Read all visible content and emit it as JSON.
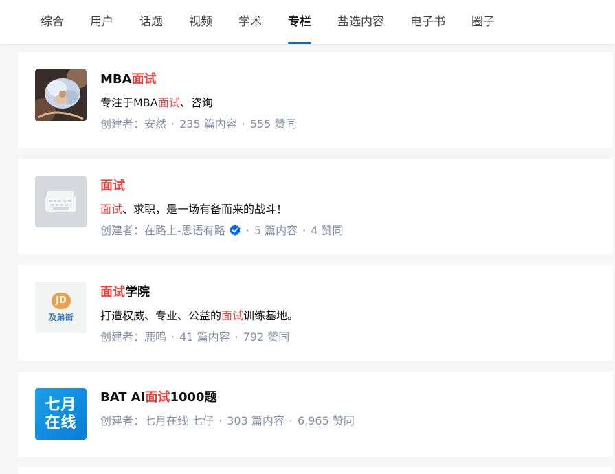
{
  "tabs": [
    "综合",
    "用户",
    "话题",
    "视频",
    "学术",
    "专栏",
    "盐选内容",
    "电子书",
    "圈子"
  ],
  "active_tab_index": 5,
  "meta_prefix": "创建者：",
  "separator": "·",
  "colors": {
    "accent": "#0066ff",
    "highlight": "#f1403c",
    "meta": "#8590a6",
    "verified": "#0066ff"
  },
  "results": [
    {
      "title_parts": [
        {
          "t": "MBA",
          "hl": false
        },
        {
          "t": "面试",
          "hl": true
        }
      ],
      "desc_parts": [
        {
          "t": "专注于MBA",
          "hl": false
        },
        {
          "t": "面试",
          "hl": true
        },
        {
          "t": "、咨询",
          "hl": false
        }
      ],
      "creator": "安然",
      "verified": false,
      "articles": "235 篇内容",
      "likes": "555 赞同",
      "thumb_icon": "flower-photo-icon"
    },
    {
      "title_parts": [
        {
          "t": "面试",
          "hl": true
        }
      ],
      "desc_parts": [
        {
          "t": "面试",
          "hl": true
        },
        {
          "t": "、求职，是一场有备而来的战斗！",
          "hl": false
        }
      ],
      "creator": "在路上-思语有路",
      "verified": true,
      "articles": "5 篇内容",
      "likes": "4 赞同",
      "thumb_icon": "typewriter-icon"
    },
    {
      "title_parts": [
        {
          "t": "面试",
          "hl": true
        },
        {
          "t": "学院",
          "hl": false
        }
      ],
      "desc_parts": [
        {
          "t": "打造权威、专业、公益的",
          "hl": false
        },
        {
          "t": "面试",
          "hl": true
        },
        {
          "t": "训练基地。",
          "hl": false
        }
      ],
      "creator": "鹿鸣",
      "verified": false,
      "articles": "41 篇内容",
      "likes": "792 赞同",
      "thumb_icon": "jidi-logo-icon",
      "thumb_text": "及弟街",
      "thumb_mark": "JD"
    },
    {
      "title_parts": [
        {
          "t": "BAT AI",
          "hl": false
        },
        {
          "t": "面试",
          "hl": true
        },
        {
          "t": "1000题",
          "hl": false
        }
      ],
      "desc_parts": [],
      "creator": "七月在线 七仔",
      "verified": false,
      "articles": "303 篇内容",
      "likes": "6,965 赞同",
      "thumb_icon": "qiyue-logo-icon",
      "thumb_lines": [
        "七月",
        "在线"
      ]
    }
  ]
}
